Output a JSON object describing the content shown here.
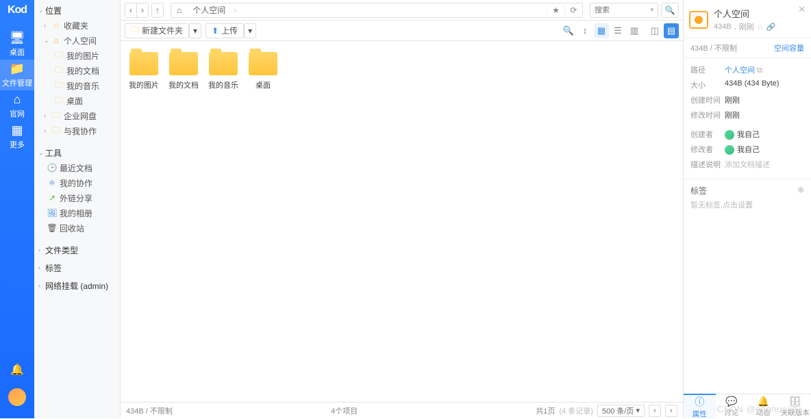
{
  "rail": {
    "logo": "Kod",
    "items": [
      {
        "icon": "🖥",
        "label": "桌面"
      },
      {
        "icon": "📁",
        "label": "文件管理"
      },
      {
        "icon": "⌂",
        "label": "官网"
      },
      {
        "icon": "▦",
        "label": "更多"
      }
    ]
  },
  "tree": {
    "location": "位置",
    "fav": "收藏夹",
    "personal": "个人空间",
    "personal_children": [
      "我的图片",
      "我的文档",
      "我的音乐",
      "桌面"
    ],
    "enterprise": "企业网盘",
    "share": "与我协作",
    "tools": "工具",
    "tool_items": [
      {
        "icon": "🕒",
        "label": "最近文档",
        "cls": "blue"
      },
      {
        "icon": "⚛",
        "label": "我的协作",
        "cls": "blue"
      },
      {
        "icon": "↗",
        "label": "外链分享",
        "cls": "green"
      },
      {
        "icon": "🖼",
        "label": "我的相册",
        "cls": "blue"
      },
      {
        "icon": "🗑",
        "label": "回收站",
        "cls": ""
      }
    ],
    "filetype": "文件类型",
    "tags": "标签",
    "mount": "网络挂载 (admin)"
  },
  "topbar": {
    "breadcrumb": "个人空间",
    "search_placeholder": "搜索"
  },
  "toolbar": {
    "new_folder": "新建文件夹",
    "upload": "上传"
  },
  "folders": [
    "我的图片",
    "我的文档",
    "我的音乐",
    "桌面"
  ],
  "status": {
    "left": "434B / 不限制",
    "center": "4个项目",
    "page_label": "共1页",
    "page_muted": "(4 条记录)",
    "per_page": "500 条/页"
  },
  "details": {
    "title": "个人空间",
    "sub1": "434B",
    "sub2": "刚刚",
    "usage_l": "434B / 不限制",
    "usage_r": "空间容量",
    "path_k": "路径",
    "path_v": "个人空间",
    "size_k": "大小",
    "size_v": "434B (434 Byte)",
    "ctime_k": "创建时间",
    "ctime_v": "刚刚",
    "mtime_k": "修改时间",
    "mtime_v": "刚刚",
    "creator_k": "创建者",
    "creator_v": "我自己",
    "modifier_k": "修改者",
    "modifier_v": "我自己",
    "desc_k": "描述说明",
    "desc_v": "添加文档描述",
    "tags_label": "标签",
    "tags_hint": "暂无标签,点击设置",
    "tabs": [
      "属性",
      "讨论",
      "动态",
      "关联版本"
    ]
  },
  "watermark": "CSDN @onghuajie"
}
